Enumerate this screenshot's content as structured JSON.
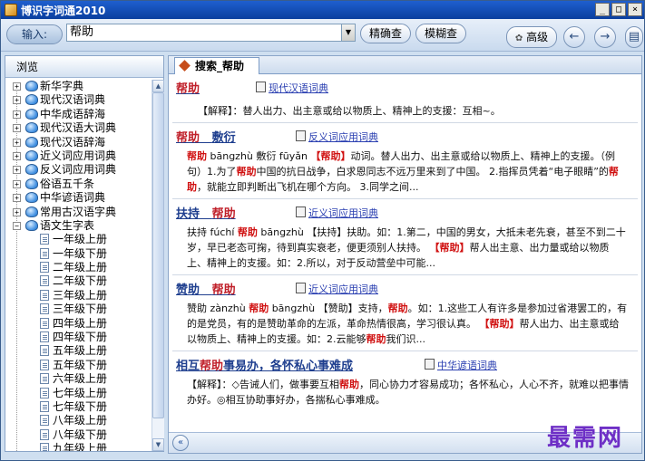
{
  "window": {
    "title": "博识字词通2010"
  },
  "toolbar": {
    "input_label": "输入:",
    "search_value": "帮助",
    "exact_search_label": "精确查",
    "fuzzy_search_label": "模糊查",
    "advanced_label": "高级"
  },
  "sidebar": {
    "header": "浏览",
    "items": [
      {
        "label": "新华字典"
      },
      {
        "label": "现代汉语词典"
      },
      {
        "label": "中华成语辞海"
      },
      {
        "label": "现代汉语大词典"
      },
      {
        "label": "现代汉语辞海"
      },
      {
        "label": "近义词应用词典"
      },
      {
        "label": "反义词应用词典"
      },
      {
        "label": "俗语五千条"
      },
      {
        "label": "中华谚语词典"
      },
      {
        "label": "常用古汉语字典"
      },
      {
        "label": "语文生字表"
      }
    ],
    "children": [
      {
        "label": "一年级上册"
      },
      {
        "label": "一年级下册"
      },
      {
        "label": "二年级上册"
      },
      {
        "label": "二年级下册"
      },
      {
        "label": "三年级上册"
      },
      {
        "label": "三年级下册"
      },
      {
        "label": "四年级上册"
      },
      {
        "label": "四年级下册"
      },
      {
        "label": "五年级上册"
      },
      {
        "label": "五年级下册"
      },
      {
        "label": "六年级上册"
      },
      {
        "label": "七年级上册"
      },
      {
        "label": "七年级下册"
      },
      {
        "label": "八年级上册"
      },
      {
        "label": "八年级下册"
      },
      {
        "label": "九年级上册"
      }
    ]
  },
  "tab": {
    "label": "搜索_帮助"
  },
  "entries": [
    {
      "title": "帮助",
      "dict": "现代汉语词典",
      "body": "【解释】：替人出力、出主意或给以物质上、精神上的支援：互相~。"
    },
    {
      "title_a": "帮助",
      "title_b": "敷衍",
      "dict": "反义词应用词典",
      "body_1": "帮助",
      "body_2": " bāngzhù 敷衍 fūyǎn ",
      "body_3": "【帮助】",
      "body_4": "动词。替人出力、出主意或给以物质上、精神上的支援。（例句）1.为了",
      "body_5": "帮助",
      "body_6": "中国的抗日战争，白求恩同志不远万里来到了中国。 2.指挥员凭着“电子眼睛”的",
      "body_7": "帮助",
      "body_8": "，就能立即判断出飞机在哪个方向。 3.同学之间..."
    },
    {
      "title_a": "扶持",
      "title_b": "帮助",
      "dict": "近义词应用词典",
      "body_1": "扶持 fúchí ",
      "body_2": "帮助",
      "body_3": " bāngzhù 【扶持】扶助。如：1.第二，中国的男女，大抵未老先衰，甚至不到二十岁，早已老态可掬，待到真实衰老，便更须别人扶持。 ",
      "body_4": "【帮助】",
      "body_5": "帮人出主意、出力量或给以物质上、精神上的支援。如：2.所以，对于反动营垒中可能..."
    },
    {
      "title_a": "赞助",
      "title_b": "帮助",
      "dict": "近义词应用词典",
      "body_1": "赞助 zànzhù ",
      "body_2": "帮助",
      "body_3": " bāngzhù 【赞助】支持，",
      "body_4": "帮助",
      "body_5": "。如：1.这些工人有许多是参加过省港罢工的，有的是党员，有的是赞助革命的左派，革命热情很高，学习很认真。 ",
      "body_6": "【帮助】",
      "body_7": "帮人出力、出主意或给以物质上、精神上的支援。如：2.云能够",
      "body_8": "帮助",
      "body_9": "我们识..."
    },
    {
      "title_a": "相互",
      "title_b": "帮助",
      "title_c": "事易办，各怀私心事难成",
      "dict": "中华谚语词典",
      "body_1": "【解释】：◇告诫人们，做事要互相",
      "body_2": "帮助",
      "body_3": "，同心协力才容易成功；各怀私心，人心不齐，就难以把事情办好。◎相互协助事好办，各揣私心事难成。"
    }
  ],
  "watermark": "最需网"
}
